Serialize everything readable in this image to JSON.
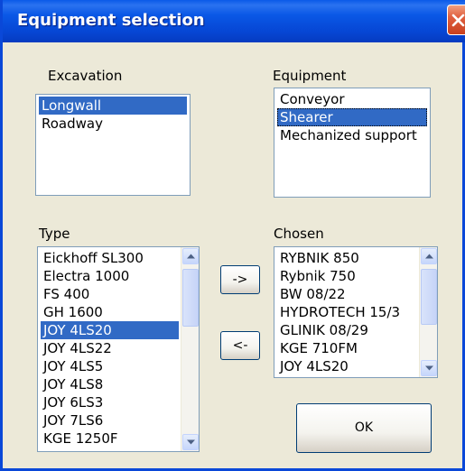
{
  "window": {
    "title": "Equipment selection",
    "close_label": "X"
  },
  "excavation": {
    "label": "Excavation",
    "items": [
      "Longwall",
      "Roadway"
    ],
    "selected": "Longwall"
  },
  "equipment": {
    "label": "Equipment",
    "items": [
      "Conveyor",
      "Shearer",
      "Mechanized support"
    ],
    "selected": "Shearer"
  },
  "type": {
    "label": "Type",
    "items": [
      "Eickhoff SL300",
      "Electra 1000",
      "FS 400",
      "GH 1600",
      "JOY 4LS20",
      "JOY 4LS22",
      "JOY 4LS5",
      "JOY 4LS8",
      "JOY 6LS3",
      "JOY 7LS6",
      "KGE 1250F"
    ],
    "selected": "JOY 4LS20"
  },
  "chosen": {
    "label": "Chosen",
    "items": [
      "RYBNIK 850",
      "Rybnik 750",
      "BW 08/22",
      "HYDROTECH 15/3",
      "GLINIK 08/29",
      "KGE 710FM",
      "JOY 4LS20"
    ]
  },
  "buttons": {
    "add": "->",
    "remove": "<-",
    "ok": "OK"
  },
  "icons": {
    "close": "close-icon",
    "scroll_up": "scroll-up-arrow-icon",
    "scroll_down": "scroll-down-arrow-icon"
  },
  "colors": {
    "title_bar": "#0a58e6",
    "selection": "#316ac5",
    "close_button": "#e06040"
  }
}
